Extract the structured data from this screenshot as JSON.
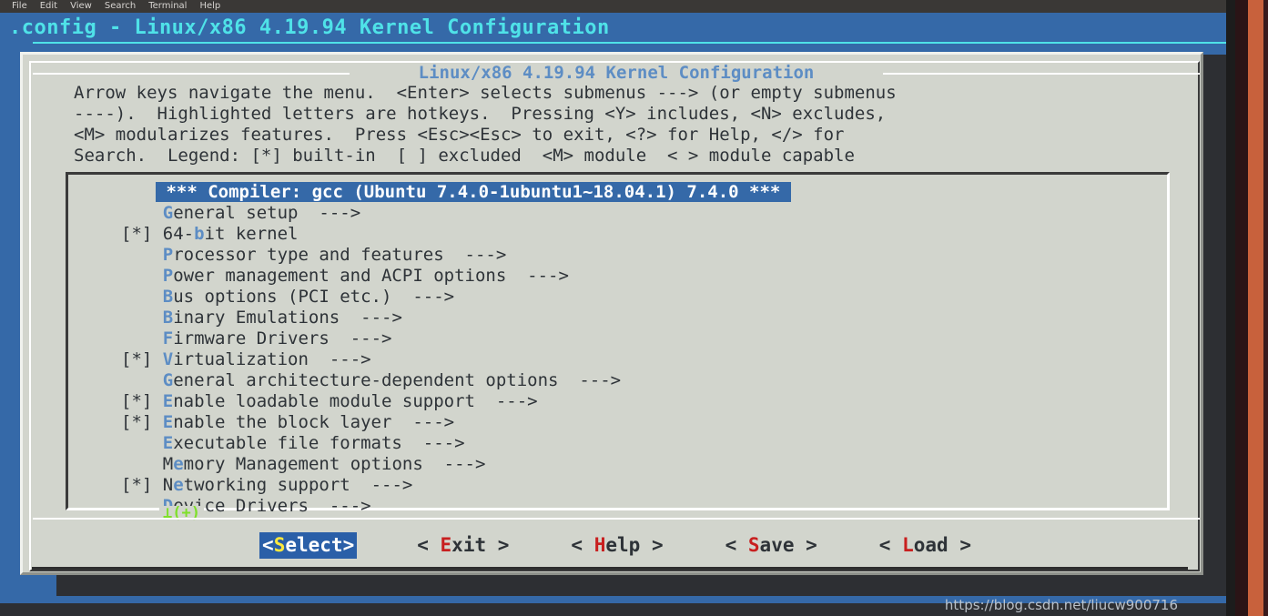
{
  "menubar": {
    "items": [
      "File",
      "Edit",
      "View",
      "Search",
      "Terminal",
      "Help"
    ]
  },
  "terminal": {
    "title": ".config - Linux/x86 4.19.94 Kernel Configuration"
  },
  "dialog": {
    "title": "Linux/x86 4.19.94 Kernel Configuration",
    "help_text": "Arrow keys navigate the menu.  <Enter> selects submenus ---> (or empty submenus\n----).  Highlighted letters are hotkeys.  Pressing <Y> includes, <N> excludes,\n<M> modularizes features.  Press <Esc><Esc> to exit, <?> for Help, </> for\nSearch.  Legend: [*] built-in  [ ] excluded  <M> module  < > module capable",
    "scroll_indicator": "⊥(+)"
  },
  "menu": {
    "selected_index": 0,
    "rows": [
      {
        "marker": "",
        "hotkey": "",
        "before": "",
        "after": "*** Compiler: gcc (Ubuntu 7.4.0-1ubuntu1~18.04.1) 7.4.0 ***",
        "arrow": "",
        "selected": true
      },
      {
        "marker": "",
        "hotkey": "G",
        "before": "",
        "after": "eneral setup",
        "arrow": "  --->",
        "selected": false
      },
      {
        "marker": "[*] ",
        "hotkey": "b",
        "before": "64-",
        "after": "it kernel",
        "arrow": "",
        "selected": false
      },
      {
        "marker": "",
        "hotkey": "P",
        "before": "",
        "after": "rocessor type and features",
        "arrow": "  --->",
        "selected": false
      },
      {
        "marker": "",
        "hotkey": "P",
        "before": "",
        "after": "ower management and ACPI options",
        "arrow": "  --->",
        "selected": false
      },
      {
        "marker": "",
        "hotkey": "B",
        "before": "",
        "after": "us options (PCI etc.)",
        "arrow": "  --->",
        "selected": false
      },
      {
        "marker": "",
        "hotkey": "B",
        "before": "",
        "after": "inary Emulations",
        "arrow": "  --->",
        "selected": false
      },
      {
        "marker": "",
        "hotkey": "F",
        "before": "",
        "after": "irmware Drivers",
        "arrow": "  --->",
        "selected": false
      },
      {
        "marker": "[*] ",
        "hotkey": "V",
        "before": "",
        "after": "irtualization",
        "arrow": "  --->",
        "selected": false
      },
      {
        "marker": "",
        "hotkey": "G",
        "before": "",
        "after": "eneral architecture-dependent options",
        "arrow": "  --->",
        "selected": false
      },
      {
        "marker": "[*] ",
        "hotkey": "E",
        "before": "",
        "after": "nable loadable module support",
        "arrow": "  --->",
        "selected": false
      },
      {
        "marker": "[*] ",
        "hotkey": "E",
        "before": "",
        "after": "nable the block layer",
        "arrow": "  --->",
        "selected": false
      },
      {
        "marker": "",
        "hotkey": "E",
        "before": "",
        "after": "xecutable file formats",
        "arrow": "  --->",
        "selected": false
      },
      {
        "marker": "",
        "hotkey": "e",
        "before": "M",
        "after": "mory Management options",
        "arrow": "  --->",
        "selected": false
      },
      {
        "marker": "[*] ",
        "hotkey": "e",
        "before": "N",
        "after": "tworking support",
        "arrow": "  --->",
        "selected": false
      },
      {
        "marker": "",
        "hotkey": "D",
        "before": "",
        "after": "evice Drivers",
        "arrow": "  --->",
        "selected": false
      }
    ]
  },
  "buttons": [
    {
      "open": "<",
      "hotkey": "S",
      "rest": "elect",
      "close": ">",
      "active": true
    },
    {
      "open": "< ",
      "hotkey": "E",
      "rest": "xit",
      "close": " >",
      "active": false
    },
    {
      "open": "< ",
      "hotkey": "H",
      "rest": "elp",
      "close": " >",
      "active": false
    },
    {
      "open": "< ",
      "hotkey": "S",
      "rest": "ave",
      "close": " >",
      "active": false
    },
    {
      "open": "< ",
      "hotkey": "L",
      "rest": "oad",
      "close": " >",
      "active": false
    }
  ],
  "watermark": "https://blog.csdn.net/liucw900716"
}
